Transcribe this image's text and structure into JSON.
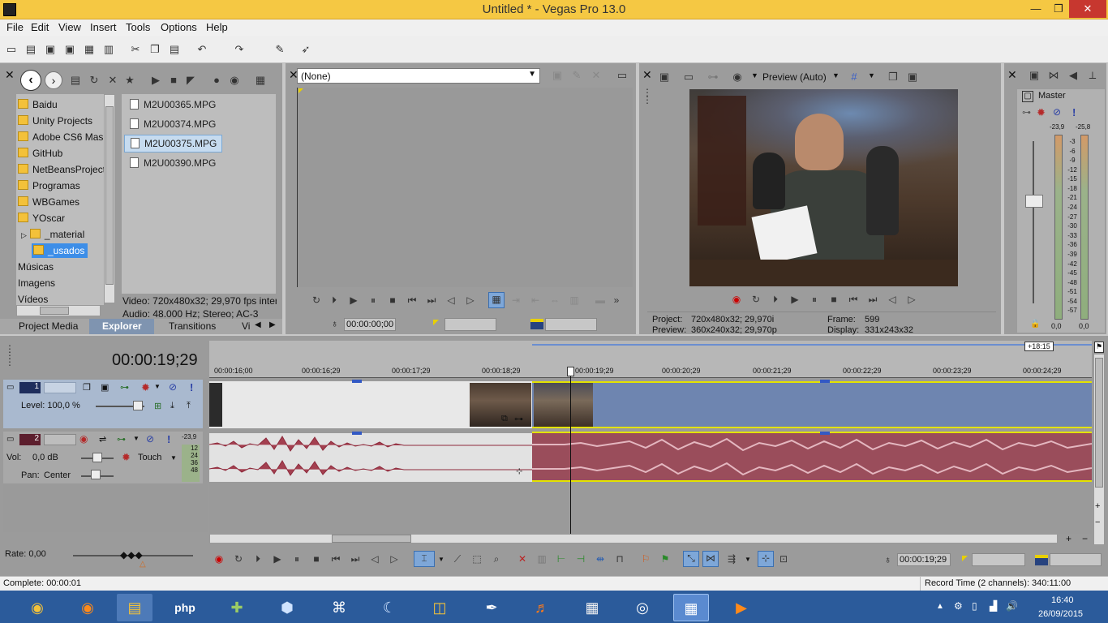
{
  "app": {
    "title": "Untitled * - Vegas Pro 13.0",
    "min": "—",
    "max": "❐",
    "close": "✕"
  },
  "menu": [
    "File",
    "Edit",
    "View",
    "Insert",
    "Tools",
    "Options",
    "Help"
  ],
  "explorer": {
    "folders": [
      "Baidu",
      "Unity Projects",
      "Adobe CS6 Mas",
      "GitHub",
      "NetBeansProject",
      "Programas",
      "WBGames",
      "YOscar",
      "_material",
      "_usados",
      "Músicas",
      "Imagens",
      "Vídeos"
    ],
    "selected_folder": "_usados",
    "files": [
      "M2U00365.MPG",
      "M2U00374.MPG",
      "M2U00375.MPG",
      "M2U00390.MPG"
    ],
    "selected_file": "M2U00375.MPG",
    "info_video": "Video: 720x480x32; 29,970 fps interl",
    "info_audio": "Audio: 48.000 Hz; Stereo; AC-3",
    "tabs": [
      "Project Media",
      "Explorer",
      "Transitions",
      "Vi"
    ],
    "active_tab": "Explorer"
  },
  "trimmer": {
    "dropdown": "(None)",
    "timecode": "00:00:00;00"
  },
  "preview": {
    "quality": "Preview (Auto)",
    "project_label": "Project:",
    "project_value": "720x480x32; 29,970i",
    "preview_label": "Preview:",
    "preview_value": "360x240x32; 29,970p",
    "frame_label": "Frame:",
    "frame_value": "599",
    "display_label": "Display:",
    "display_value": "331x243x32"
  },
  "master": {
    "label": "Master",
    "left_peak": "-23,9",
    "right_peak": "-25,8",
    "scale": [
      "3",
      "6",
      "9",
      "12",
      "15",
      "18",
      "21",
      "24",
      "27",
      "30",
      "33",
      "36",
      "39",
      "42",
      "45",
      "48",
      "51",
      "54",
      "57"
    ],
    "left_value": "0,0",
    "right_value": "0,0"
  },
  "timeline": {
    "cursor_time": "00:00:19;29",
    "marker_label": "+18:15",
    "ruler": [
      "00:00:16;00",
      "00:00:16;29",
      "00:00:17;29",
      "00:00:18;29",
      "00:00:19;29",
      "00:00:20;29",
      "00:00:21;29",
      "00:00:22;29",
      "00:00:23;29",
      "00:00:24;29"
    ],
    "track1": {
      "number": "1",
      "level_label": "Level: 100,0 %"
    },
    "track2": {
      "number": "2",
      "vol_label": "Vol:",
      "vol_value": "0,0 dB",
      "pan_label": "Pan:",
      "pan_value": "Center",
      "mode": "Touch",
      "meter_values": [
        "-23,9",
        "12",
        "24",
        "36",
        "48"
      ]
    },
    "rate_label": "Rate: 0,00",
    "bottom_timecode": "00:00:19;29"
  },
  "status": {
    "left": "Complete: 00:00:01",
    "right": "Record Time (2 channels): 340:11:00"
  },
  "tray": {
    "time": "16:40",
    "date": "26/09/2015"
  },
  "colors": {
    "titlebar": "#f5c843",
    "video_track": "#a9b9cf",
    "audio_event": "#9a4d5b",
    "taskbar": "#2b5b9b"
  }
}
